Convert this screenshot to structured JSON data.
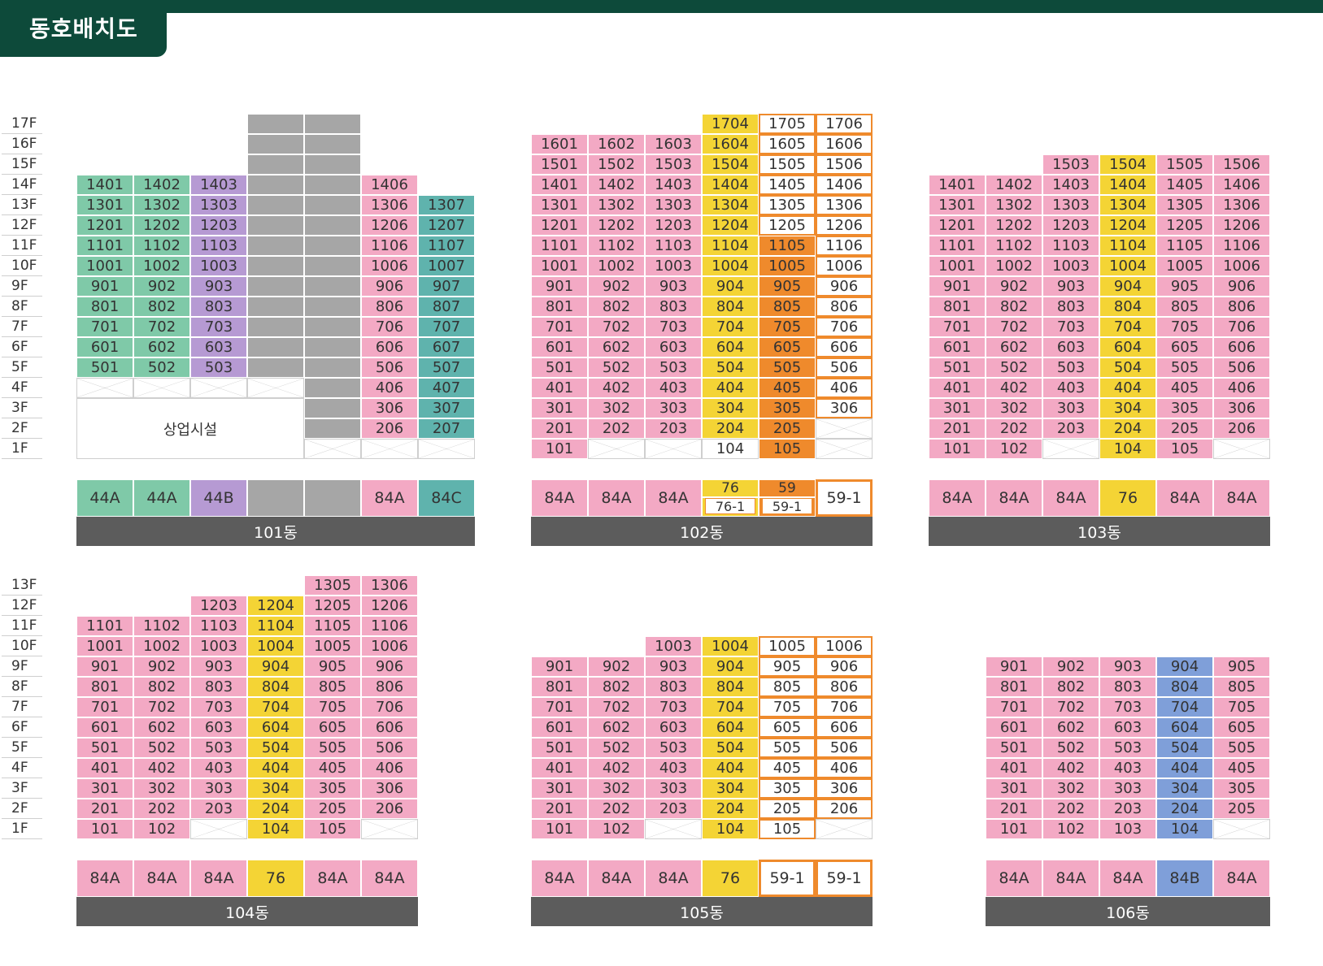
{
  "title": "동호배치도",
  "colors": {
    "brand": "#0d4a3a",
    "pink": "#f3a9c4",
    "green": "#7fc9a8",
    "purple": "#b69ad3",
    "gray": "#a6a6a6",
    "teal": "#5fb3ad",
    "yellow": "#f4d435",
    "orange": "#ef8a2c",
    "blue": "#7f9fd9",
    "white": "#ffffff",
    "bar": "#5c5c5c"
  },
  "floors_top": [
    "17F",
    "16F",
    "15F",
    "14F",
    "13F",
    "12F",
    "11F",
    "10F",
    "9F",
    "8F",
    "7F",
    "6F",
    "5F",
    "4F",
    "3F",
    "2F",
    "1F"
  ],
  "floors_bottom": [
    "13F",
    "12F",
    "11F",
    "10F",
    "9F",
    "8F",
    "7F",
    "6F",
    "5F",
    "4F",
    "3F",
    "2F",
    "1F"
  ],
  "buildings": [
    {
      "name": "101동",
      "commercial_label": "상업시설",
      "columns": [
        {
          "type": "44A",
          "color": "green",
          "units": [
            [
              "1401",
              "1301",
              "1201",
              "1101",
              "1001",
              "901",
              "801",
              "701",
              "601",
              "501"
            ]
          ]
        },
        {
          "type": "44A",
          "color": "green",
          "units": [
            [
              "1402",
              "1302",
              "1202",
              "1102",
              "1002",
              "902",
              "802",
              "702",
              "602",
              "502"
            ]
          ]
        },
        {
          "type": "44B",
          "color": "purple",
          "units": [
            [
              "1403",
              "1303",
              "1203",
              "1103",
              "1003",
              "903",
              "803",
              "703",
              "603",
              "503"
            ]
          ]
        },
        {
          "type": "",
          "color": "gray",
          "units": []
        },
        {
          "type": "",
          "color": "gray",
          "units": []
        },
        {
          "type": "84A",
          "color": "pink",
          "units": [
            [
              "1406",
              "1306",
              "1206",
              "1106",
              "1006",
              "906",
              "806",
              "706",
              "606",
              "506",
              "406",
              "306",
              "206"
            ]
          ]
        },
        {
          "type": "84C",
          "color": "teal",
          "units": [
            [
              "1307",
              "1207",
              "1107",
              "1007",
              "907",
              "807",
              "707",
              "607",
              "507",
              "407",
              "307",
              "207"
            ]
          ]
        }
      ]
    },
    {
      "name": "102동",
      "columns": [
        {
          "type": "84A",
          "color": "pink",
          "units": [
            [
              "1601",
              "1501",
              "1401",
              "1301",
              "1201",
              "1101",
              "1001",
              "901",
              "801",
              "701",
              "601",
              "501",
              "401",
              "301",
              "201",
              "101"
            ]
          ]
        },
        {
          "type": "84A",
          "color": "pink",
          "units": [
            [
              "1602",
              "1502",
              "1402",
              "1302",
              "1202",
              "1102",
              "1002",
              "902",
              "802",
              "702",
              "602",
              "502",
              "402",
              "302",
              "202"
            ]
          ]
        },
        {
          "type": "84A",
          "color": "pink",
          "units": [
            [
              "1603",
              "1503",
              "1403",
              "1303",
              "1203",
              "1103",
              "1003",
              "903",
              "803",
              "703",
              "603",
              "503",
              "403",
              "303",
              "203"
            ]
          ]
        },
        {
          "type": "76",
          "type2": "76-1",
          "color": "yellow",
          "units": [
            [
              "1704",
              "1604",
              "1504",
              "1404",
              "1304",
              "1204",
              "1104",
              "1004",
              "904",
              "804",
              "704",
              "604",
              "504",
              "404",
              "304",
              "204",
              "104"
            ]
          ]
        },
        {
          "type": "59",
          "type2": "59-1",
          "color": "orange",
          "units": [
            [
              "1705",
              "1605",
              "1505",
              "1405",
              "1305",
              "1205",
              "1105",
              "1005",
              "905",
              "805",
              "705",
              "605",
              "505",
              "405",
              "305",
              "205",
              "105"
            ]
          ]
        },
        {
          "type": "59-1",
          "color": "white",
          "units": [
            [
              "1706",
              "1606",
              "1506",
              "1406",
              "1306",
              "1206",
              "1106",
              "1006",
              "906",
              "806",
              "706",
              "606",
              "506",
              "406",
              "306"
            ]
          ]
        }
      ]
    },
    {
      "name": "103동",
      "columns": [
        {
          "type": "84A",
          "color": "pink",
          "units": [
            [
              "1401",
              "1301",
              "1201",
              "1101",
              "1001",
              "901",
              "801",
              "701",
              "601",
              "501",
              "401",
              "301",
              "201",
              "101"
            ]
          ]
        },
        {
          "type": "84A",
          "color": "pink",
          "units": [
            [
              "1402",
              "1302",
              "1202",
              "1102",
              "1002",
              "902",
              "802",
              "702",
              "602",
              "502",
              "402",
              "302",
              "202",
              "102"
            ]
          ]
        },
        {
          "type": "84A",
          "color": "pink",
          "units": [
            [
              "1503",
              "1403",
              "1303",
              "1203",
              "1103",
              "1003",
              "903",
              "803",
              "703",
              "603",
              "503",
              "403",
              "303",
              "203"
            ]
          ]
        },
        {
          "type": "76",
          "color": "yellow",
          "units": [
            [
              "1504",
              "1404",
              "1304",
              "1204",
              "1104",
              "1004",
              "904",
              "804",
              "704",
              "604",
              "504",
              "404",
              "304",
              "204",
              "104"
            ]
          ]
        },
        {
          "type": "84A",
          "color": "pink",
          "units": [
            [
              "1505",
              "1405",
              "1305",
              "1205",
              "1105",
              "1005",
              "905",
              "805",
              "705",
              "605",
              "505",
              "405",
              "305",
              "205",
              "105"
            ]
          ]
        },
        {
          "type": "84A",
          "color": "pink",
          "units": [
            [
              "1506",
              "1406",
              "1306",
              "1206",
              "1106",
              "1006",
              "906",
              "806",
              "706",
              "606",
              "506",
              "406",
              "306",
              "206"
            ]
          ]
        }
      ]
    },
    {
      "name": "104동",
      "columns": [
        {
          "type": "84A",
          "color": "pink",
          "units": [
            [
              "1101",
              "1001",
              "901",
              "801",
              "701",
              "601",
              "501",
              "401",
              "301",
              "201",
              "101"
            ]
          ]
        },
        {
          "type": "84A",
          "color": "pink",
          "units": [
            [
              "1102",
              "1002",
              "902",
              "802",
              "702",
              "602",
              "502",
              "402",
              "302",
              "202",
              "102"
            ]
          ]
        },
        {
          "type": "84A",
          "color": "pink",
          "units": [
            [
              "1203",
              "1103",
              "1003",
              "903",
              "803",
              "703",
              "603",
              "503",
              "403",
              "303",
              "203"
            ]
          ]
        },
        {
          "type": "76",
          "color": "yellow",
          "units": [
            [
              "1204",
              "1104",
              "1004",
              "904",
              "804",
              "704",
              "604",
              "504",
              "404",
              "304",
              "204",
              "104"
            ]
          ]
        },
        {
          "type": "84A",
          "color": "pink",
          "units": [
            [
              "1305",
              "1205",
              "1105",
              "1005",
              "905",
              "805",
              "705",
              "605",
              "505",
              "405",
              "305",
              "205",
              "105"
            ]
          ]
        },
        {
          "type": "84A",
          "color": "pink",
          "units": [
            [
              "1306",
              "1206",
              "1106",
              "1006",
              "906",
              "806",
              "706",
              "606",
              "506",
              "406",
              "306",
              "206"
            ]
          ]
        }
      ]
    },
    {
      "name": "105동",
      "columns": [
        {
          "type": "84A",
          "color": "pink",
          "units": [
            [
              "901",
              "801",
              "701",
              "601",
              "501",
              "401",
              "301",
              "201",
              "101"
            ]
          ]
        },
        {
          "type": "84A",
          "color": "pink",
          "units": [
            [
              "902",
              "802",
              "702",
              "602",
              "502",
              "402",
              "302",
              "202",
              "102"
            ]
          ]
        },
        {
          "type": "84A",
          "color": "pink",
          "units": [
            [
              "1003",
              "903",
              "803",
              "703",
              "603",
              "503",
              "403",
              "303",
              "203"
            ]
          ]
        },
        {
          "type": "76",
          "color": "yellow",
          "units": [
            [
              "1004",
              "904",
              "804",
              "704",
              "604",
              "504",
              "404",
              "304",
              "204",
              "104"
            ]
          ]
        },
        {
          "type": "59-1",
          "color": "white",
          "units": [
            [
              "1005",
              "905",
              "805",
              "705",
              "605",
              "505",
              "405",
              "305",
              "205",
              "105"
            ]
          ]
        },
        {
          "type": "59-1",
          "color": "white",
          "units": [
            [
              "1006",
              "906",
              "806",
              "706",
              "606",
              "506",
              "406",
              "306",
              "206"
            ]
          ]
        }
      ]
    },
    {
      "name": "106동",
      "columns": [
        {
          "type": "84A",
          "color": "pink",
          "units": [
            [
              "901",
              "801",
              "701",
              "601",
              "501",
              "401",
              "301",
              "201",
              "101"
            ]
          ]
        },
        {
          "type": "84A",
          "color": "pink",
          "units": [
            [
              "902",
              "802",
              "702",
              "602",
              "502",
              "402",
              "302",
              "202",
              "102"
            ]
          ]
        },
        {
          "type": "84A",
          "color": "pink",
          "units": [
            [
              "903",
              "803",
              "703",
              "603",
              "503",
              "403",
              "303",
              "203",
              "103"
            ]
          ]
        },
        {
          "type": "84B",
          "color": "blue",
          "units": [
            [
              "904",
              "804",
              "704",
              "604",
              "504",
              "404",
              "304",
              "204",
              "104"
            ]
          ]
        },
        {
          "type": "84A",
          "color": "pink",
          "units": [
            [
              "905",
              "805",
              "705",
              "605",
              "505",
              "405",
              "305",
              "205"
            ]
          ]
        }
      ]
    }
  ]
}
